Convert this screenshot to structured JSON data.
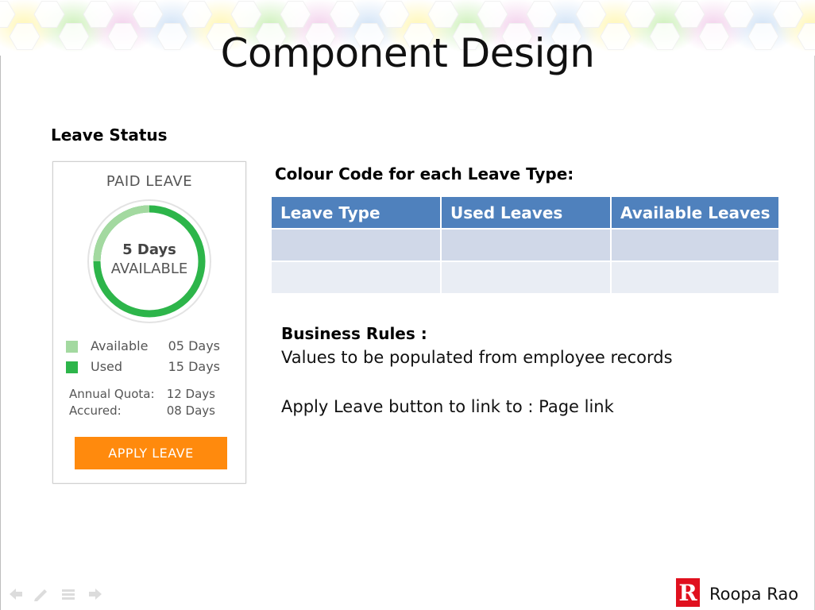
{
  "slide": {
    "title": "Component Design",
    "section_heading": "Leave Status"
  },
  "card": {
    "title": "PAID LEAVE",
    "ring_line1": "5 Days",
    "ring_line2": "AVAILABLE",
    "available_fraction": 0.25,
    "legend": [
      {
        "label": "Available",
        "value": "05 Days",
        "color": "#a3d9a0"
      },
      {
        "label": "Used",
        "value": "15 Days",
        "color": "#2db54a"
      }
    ],
    "quota": [
      {
        "label": "Annual Quota:",
        "value": "12 Days"
      },
      {
        "label": "Accured:",
        "value": "08 Days"
      }
    ],
    "apply_button": "APPLY LEAVE"
  },
  "colour_code": {
    "heading": "Colour Code for each Leave Type:",
    "columns": [
      "Leave Type",
      "Used Leaves",
      "Available Leaves"
    ],
    "header_color": "#4f81bd"
  },
  "business_rules": {
    "heading": "Business Rules :",
    "lines": [
      "Values to be populated from employee records",
      "Apply Leave button to link to : Page link"
    ]
  },
  "footer": {
    "author": "Roopa Rao",
    "logo_letter": "R"
  },
  "colors": {
    "accent_orange": "#ff8a0d",
    "ring_used": "#2db54a",
    "ring_available": "#a3d9a0",
    "logo_red": "#e0101e"
  }
}
